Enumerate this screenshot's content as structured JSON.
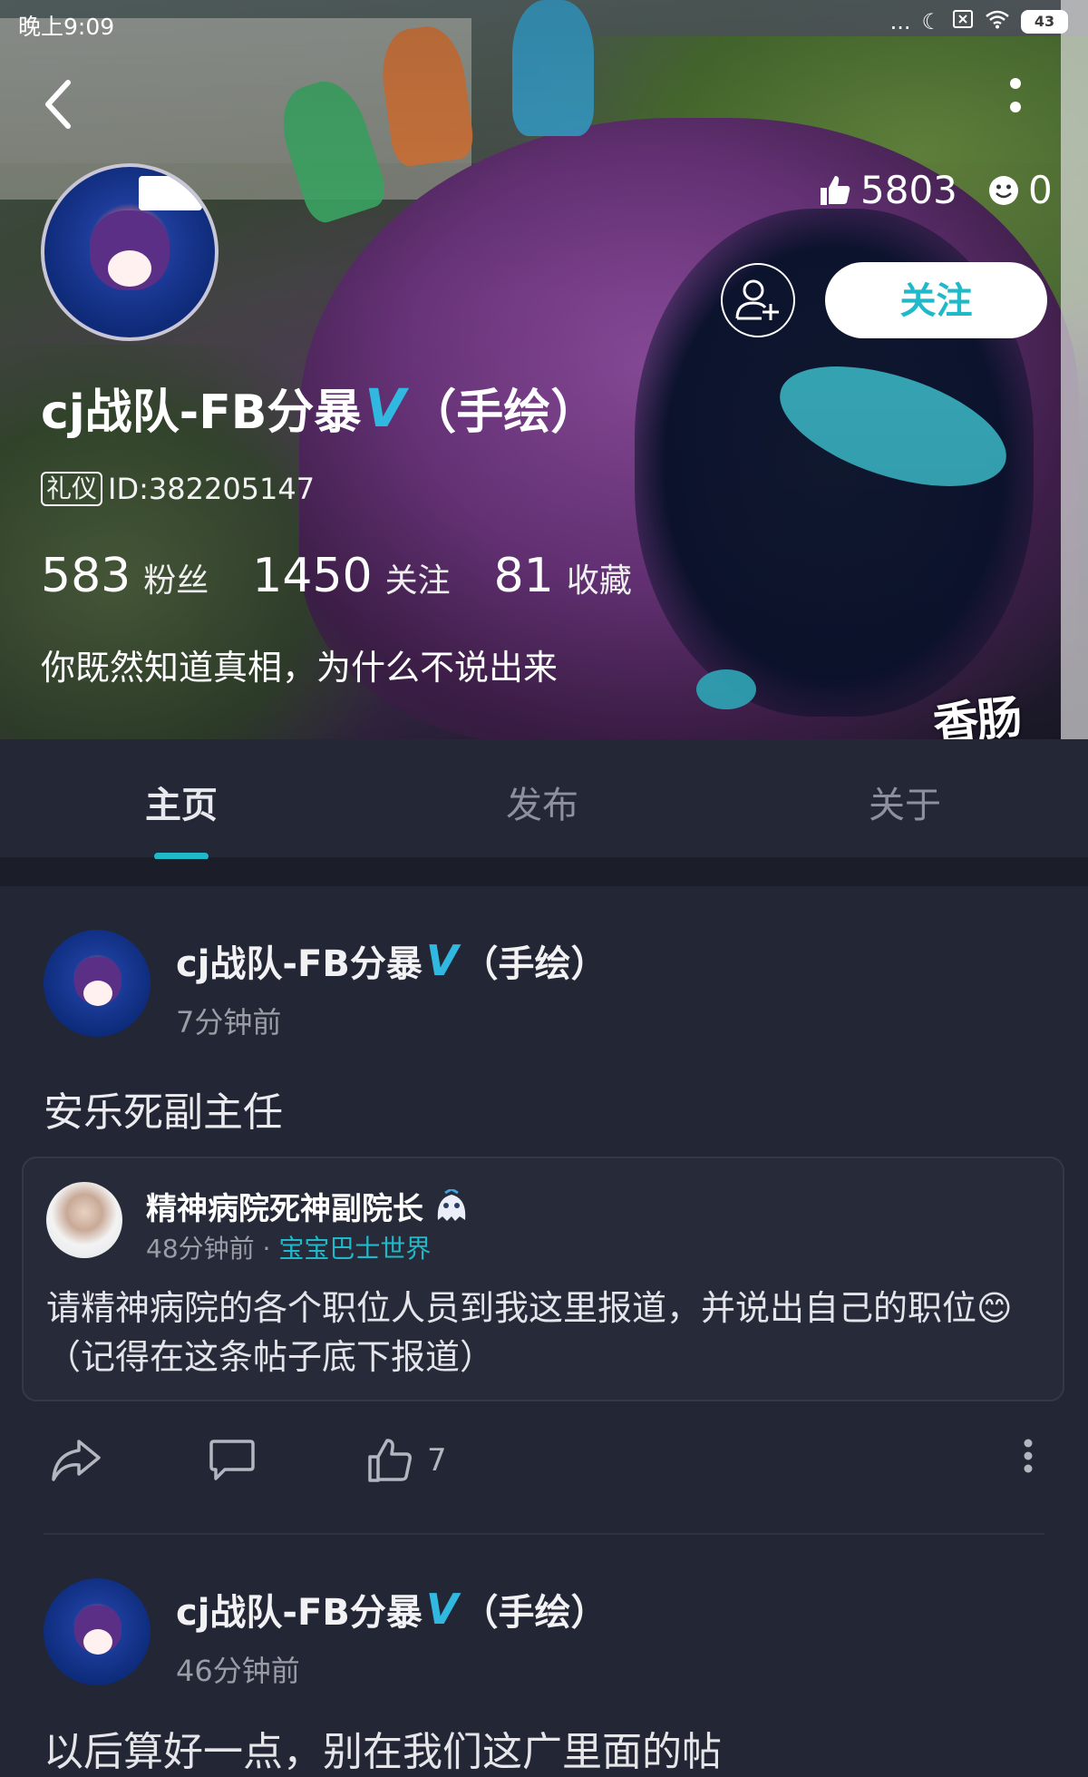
{
  "status_bar": {
    "time": "晚上9:09",
    "battery": "43",
    "dots": "..."
  },
  "profile": {
    "name": "cj战队-FB分暴",
    "name_suffix": "（手绘）",
    "verified_mark": "V",
    "badge": "礼仪",
    "id_text": "ID:382205147",
    "likes": "5803",
    "emoji_count": "0",
    "follow_label": "关注",
    "fans_count": "583",
    "fans_label": "粉丝",
    "following_count": "1450",
    "following_label": "关注",
    "favorites_count": "81",
    "favorites_label": "收藏",
    "bio": "你既然知道真相，为什么不说出来",
    "watermark": "香肠"
  },
  "tabs": [
    {
      "label": "主页",
      "active": true
    },
    {
      "label": "发布",
      "active": false
    },
    {
      "label": "关于",
      "active": false
    }
  ],
  "posts": [
    {
      "author": "cj战队-FB分暴",
      "author_suffix": "（手绘）",
      "time": "7分钟前",
      "text": "安乐死副主任",
      "quote": {
        "author": "精神病院死神副院长",
        "time": "48分钟前",
        "sep": "·",
        "topic": "宝宝巴士世界",
        "text": "请精神病院的各个职位人员到我这里报道，并说出自己的职位😊（记得在这条帖子底下报道）"
      },
      "like_count": "7"
    },
    {
      "author": "cj战队-FB分暴",
      "author_suffix": "（手绘）",
      "time": "46分钟前",
      "text_peek": "以后算好一点，别在我们这广里面的帖"
    }
  ],
  "colors": {
    "accent": "#1fb9c9",
    "verified": "#30b8e0",
    "background": "#232634"
  }
}
